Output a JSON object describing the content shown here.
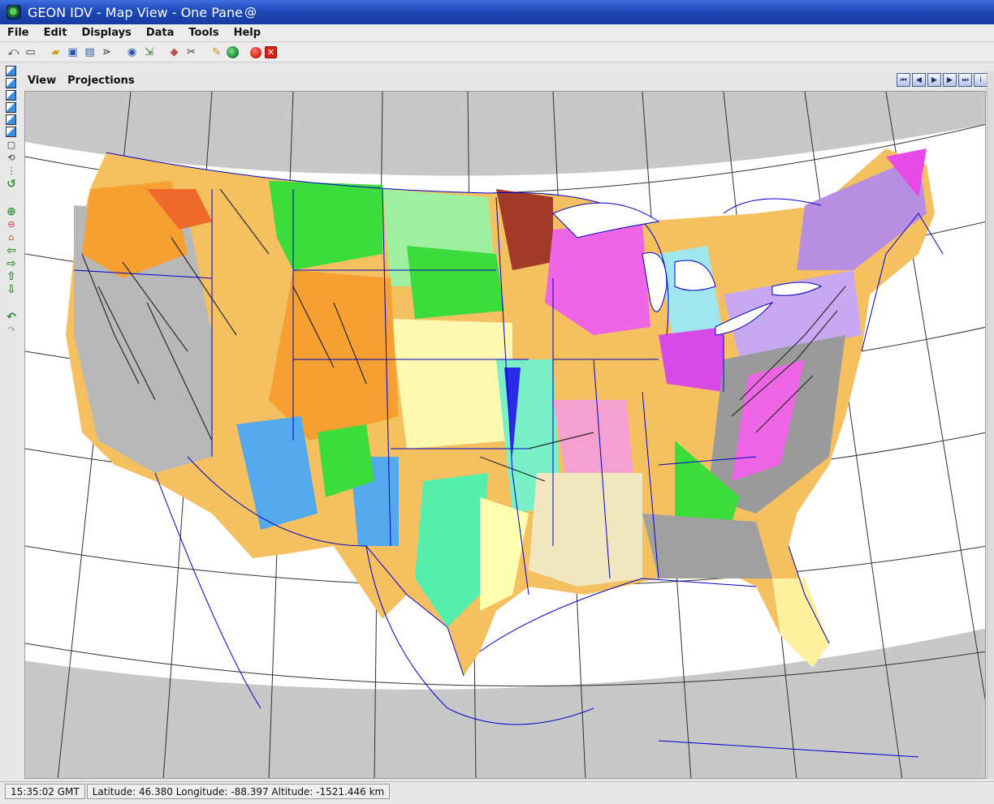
{
  "window": {
    "title": "GEON IDV - Map View - One Pane",
    "icon": "idv-globe-icon"
  },
  "menubar": {
    "items": [
      "File",
      "Edit",
      "Displays",
      "Data",
      "Tools",
      "Help"
    ]
  },
  "toolbar": {
    "icons": [
      "back-icon",
      "new-window-icon",
      "open-folder-icon",
      "save-icon",
      "save-bundle-icon",
      "data-choosers-icon",
      "help-icon",
      "image-capture-icon",
      "eraser-icon",
      "scissors-icon",
      "pencil-icon",
      "globe-icon",
      "record-icon",
      "close-icon"
    ]
  },
  "view_panel": {
    "menus": [
      "View",
      "Projections"
    ],
    "animation_buttons": [
      "first-frame-icon",
      "step-back-icon",
      "play-icon",
      "step-forward-icon",
      "last-frame-icon",
      "info-icon"
    ]
  },
  "left_toolbar": {
    "icons": [
      "view-top-icon",
      "view-bottom-icon",
      "view-north-icon",
      "view-east-icon",
      "view-south-icon",
      "view-west-icon",
      "viewbox-icon",
      "rotate-icon",
      "vertical-scale-icon",
      "reset-view-icon",
      "zoom-in-icon",
      "zoom-out-icon",
      "home-icon",
      "pan-left-icon",
      "pan-right-icon",
      "pan-up-icon",
      "pan-down-icon",
      "undo-icon",
      "redo-icon"
    ]
  },
  "map": {
    "description_colors": {
      "background": "#c8c8c8",
      "projection_fill": "#ffffff",
      "boundaries": "#0000cc",
      "graticule": "#303030"
    }
  },
  "statusbar": {
    "time": "15:35:02 GMT",
    "location": "Latitude:  46.380 Longitude: -88.397 Altitude: -1521.446 km"
  }
}
